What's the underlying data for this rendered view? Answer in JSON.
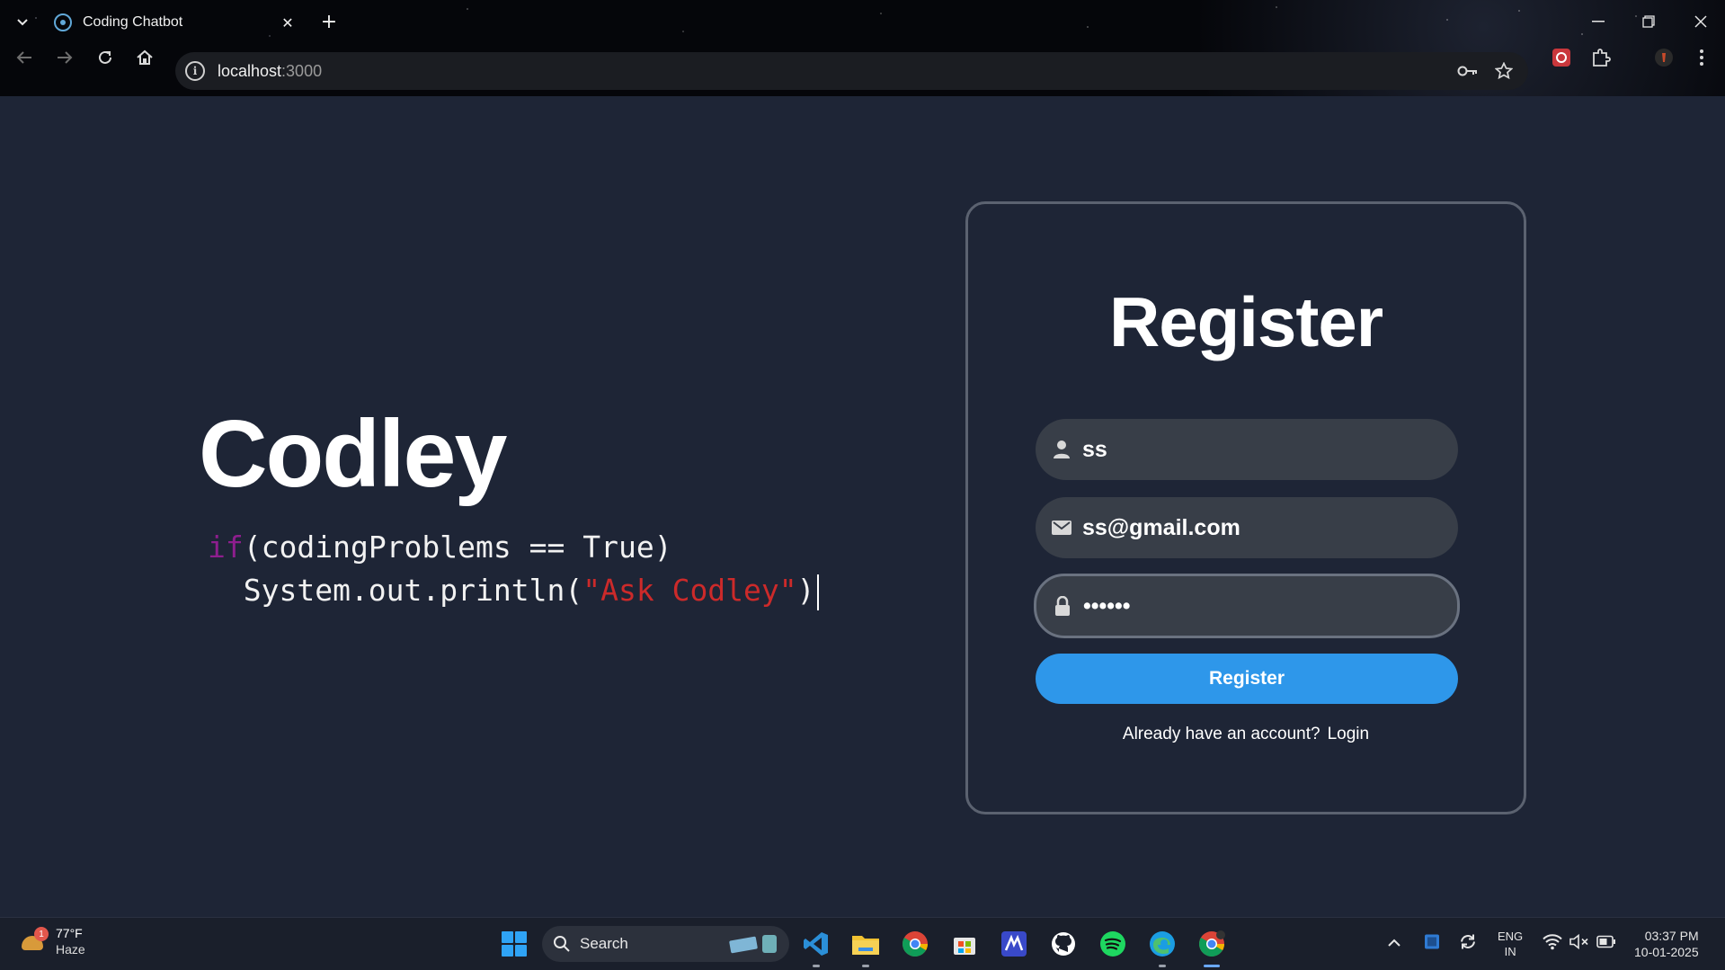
{
  "browser": {
    "tab_title": "Coding Chatbot",
    "url_host": "localhost",
    "url_port": ":3000",
    "new_tab_glyph": "+",
    "tab_close_glyph": "✕"
  },
  "hero": {
    "brand": "Codley",
    "code_keyword": "if",
    "code_line1_rest": "(codingProblems == True)",
    "code_line2_prefix": "  System.out.println(",
    "code_string": "\"Ask Codley\"",
    "code_line2_suffix": ")"
  },
  "register_form": {
    "title": "Register",
    "username_value": "ss",
    "email_value": "ss@gmail.com",
    "password_value": "••••••",
    "submit_label": "Register",
    "login_prompt": "Already have an account?",
    "login_link": "Login"
  },
  "taskbar": {
    "weather_badge": "1",
    "weather_temp": "77°F",
    "weather_condition": "Haze",
    "search_label": "Search",
    "lang_line1": "ENG",
    "lang_line2": "IN",
    "time": "03:37 PM",
    "date": "10-01-2025"
  },
  "colors": {
    "page_bg": "#1e2536",
    "accent_button": "#2e97ea",
    "code_keyword": "#8e1e8e",
    "code_string": "#cc2a2a",
    "input_bg": "#383e48"
  },
  "icons": [
    "tab-list-icon",
    "react-favicon-icon",
    "close-icon",
    "plus-icon",
    "back-icon",
    "forward-icon",
    "reload-icon",
    "home-icon",
    "site-info-icon",
    "password-key-icon",
    "bookmark-star-icon",
    "extension-icon",
    "puzzle-icon",
    "profile-icon",
    "menu-icon",
    "user-icon",
    "mail-icon",
    "lock-icon",
    "windows-start-icon",
    "search-icon",
    "vscode-icon",
    "file-explorer-icon",
    "chrome-icon",
    "store-icon",
    "github-icon",
    "spotify-icon",
    "edge-icon",
    "wifi-icon",
    "volume-muted-icon",
    "battery-icon"
  ]
}
